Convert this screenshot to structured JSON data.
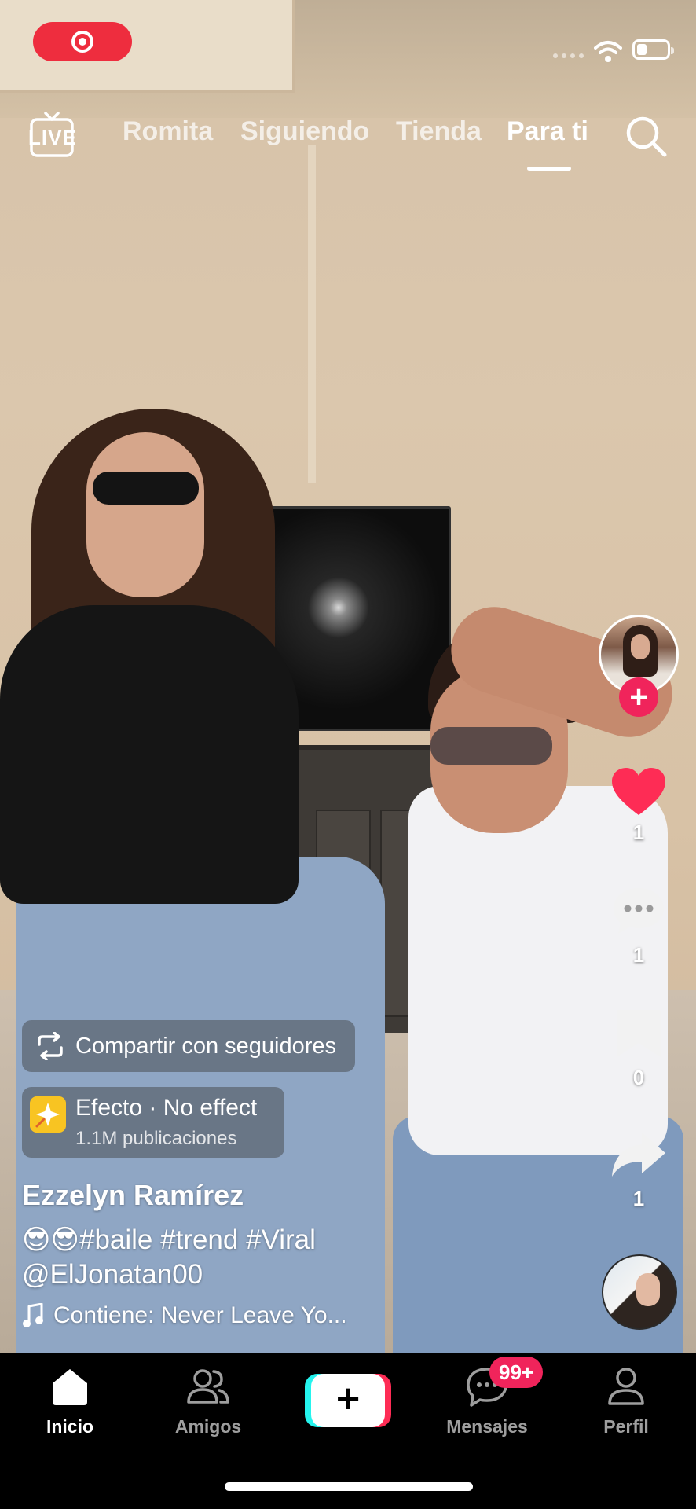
{
  "status_bar": {
    "recording_icon": "record-icon",
    "wifi_icon": "wifi-icon",
    "battery_icon": "battery-icon"
  },
  "top_nav": {
    "live_label": "LIVE",
    "tabs": [
      {
        "label": "Romita",
        "active": false
      },
      {
        "label": "Siguiendo",
        "active": false
      },
      {
        "label": "Tienda",
        "active": false
      },
      {
        "label": "Para ti",
        "active": true
      }
    ],
    "search_icon": "search-icon"
  },
  "right_rail": {
    "likes": "1",
    "comments": "1",
    "saves": "0",
    "shares": "1",
    "follow_label": "+",
    "like_color": "#fe2c55"
  },
  "overlay": {
    "share_label": "Compartir con seguidores",
    "effect": {
      "title": "Efecto · No effect",
      "subtitle": "1.1M publicaciones"
    },
    "username": "Ezzelyn Ramírez",
    "caption_line1": "😎😎#baile #trend #Viral",
    "caption_line2": "@ElJonatan00",
    "music": "Contiene: Never Leave Yo..."
  },
  "bottom_nav": {
    "items": [
      {
        "label": "Inicio",
        "active": true
      },
      {
        "label": "Amigos",
        "active": false
      },
      {
        "label": "Mensajes",
        "active": false
      },
      {
        "label": "Perfil",
        "active": false
      }
    ],
    "create_label": "+",
    "messages_badge": "99+",
    "badge_color": "#f0245b"
  }
}
